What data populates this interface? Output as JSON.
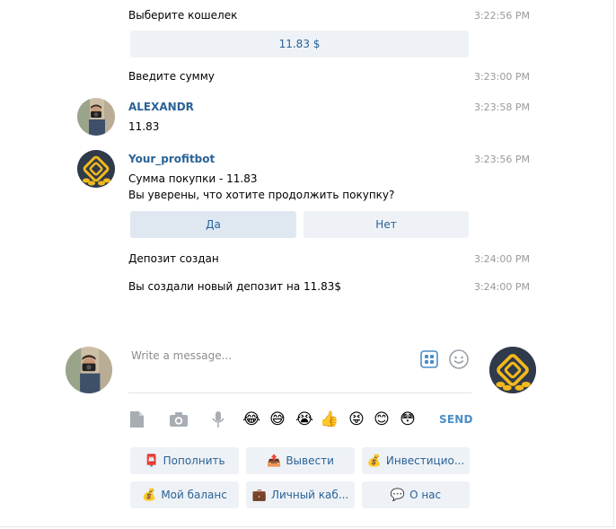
{
  "messages": [
    {
      "text": "Выберите кошелек",
      "time": "3:22:56 PM"
    },
    {
      "button": "11.83 $"
    },
    {
      "text": "Введите сумму",
      "time": "3:23:00 PM"
    },
    {
      "author": "ALEXANDR",
      "text": "11.83",
      "time": "3:23:58 PM"
    },
    {
      "author": "Your_profitbot",
      "line1": "Сумма покупки - 11.83",
      "line2": "Вы уверены, что хотите продолжить покупку?",
      "time": "3:23:56 PM",
      "buttons": [
        "Да",
        "Нет"
      ]
    },
    {
      "text": "Депозит создан",
      "time": "3:24:00 PM"
    },
    {
      "text": "Вы создали новый депозит на 11.83$",
      "time": "3:24:00 PM"
    }
  ],
  "composer": {
    "placeholder": "Write a message...",
    "send_label": "SEND",
    "emojis": [
      "😂",
      "😅",
      "😭",
      "👍",
      "😝",
      "😊",
      "😳"
    ]
  },
  "keyboard": [
    {
      "icon": "📮",
      "label": "Пополнить"
    },
    {
      "icon": "📤",
      "label": "Вывести"
    },
    {
      "icon": "💰",
      "label": "Инвестицио..."
    },
    {
      "icon": "💰",
      "label": "Мой баланс"
    },
    {
      "icon": "💼",
      "label": "Личный каб..."
    },
    {
      "icon": "💬",
      "label": "О нас"
    }
  ],
  "colors": {
    "accent": "#2b6297",
    "button_bg": "#eef2f6",
    "send": "#4a8ec7",
    "bot_avatar_bg": "#2f3a4a",
    "bot_avatar_gold": "#f2b81c"
  }
}
